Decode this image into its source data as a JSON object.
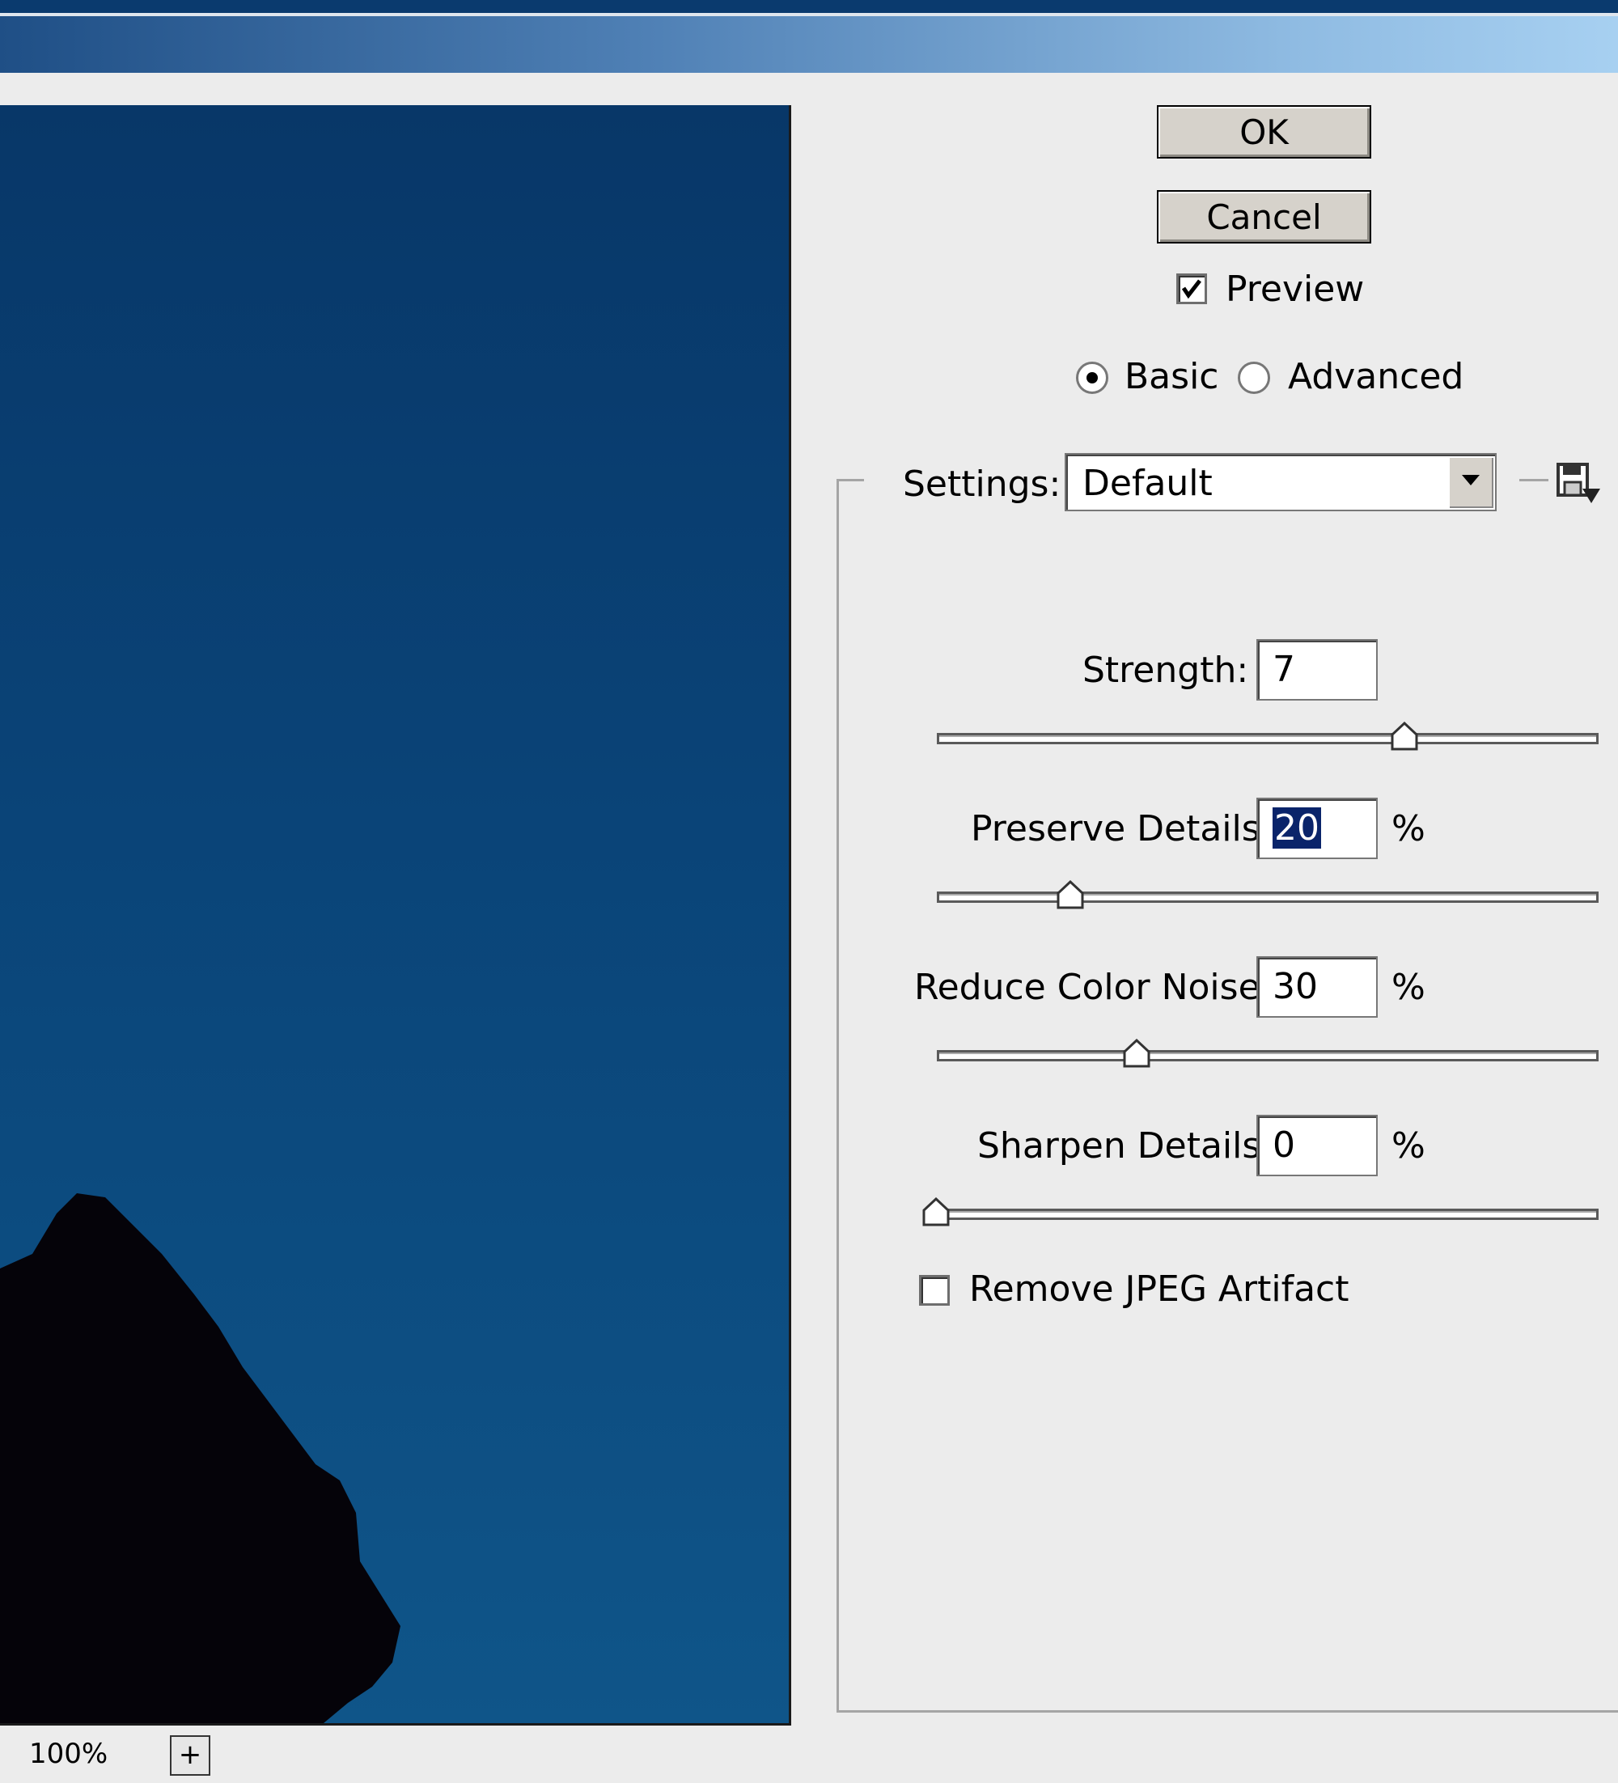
{
  "dialog": {
    "ok_label": "OK",
    "cancel_label": "Cancel",
    "preview_label": "Preview",
    "preview_checked": true,
    "mode": {
      "basic_label": "Basic",
      "advanced_label": "Advanced",
      "selected": "Basic"
    },
    "settings": {
      "label": "Settings:",
      "value": "Default",
      "save_icon": "save-settings-icon"
    },
    "controls": [
      {
        "label": "Strength:",
        "value": "7",
        "unit": "",
        "min": 0,
        "max": 10
      },
      {
        "label": "Preserve Details:",
        "value": "20",
        "unit": "%",
        "min": 0,
        "max": 100,
        "selected": true
      },
      {
        "label": "Reduce Color Noise:",
        "value": "30",
        "unit": "%",
        "min": 0,
        "max": 100
      },
      {
        "label": "Sharpen Details:",
        "value": "0",
        "unit": "%",
        "min": 0,
        "max": 100
      }
    ],
    "remove_jpeg_label": "Remove JPEG Artifact",
    "remove_jpeg_checked": false
  },
  "preview_panel": {
    "zoom_level": "100%",
    "zoom_in_label": "+"
  },
  "colors": {
    "selection": "#0a246a",
    "sky_top": "#083768",
    "sky_bottom": "#0f5589",
    "silhouette": "#050309"
  }
}
